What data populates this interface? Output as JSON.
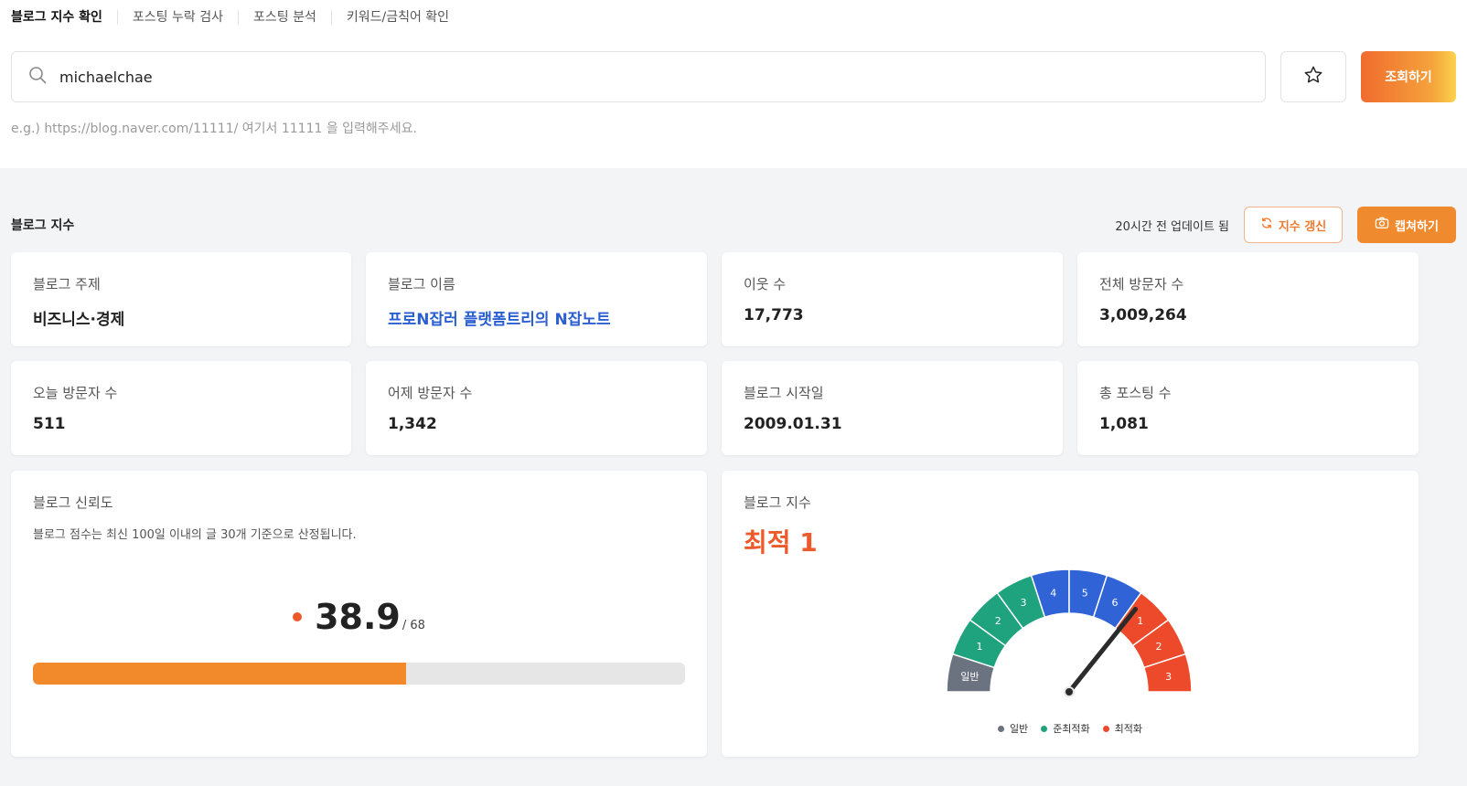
{
  "tabs": [
    "블로그 지수 확인",
    "포스팅 누락 검사",
    "포스팅 분석",
    "키워드/금칙어 확인"
  ],
  "search": {
    "value": "michaelchae",
    "button": "조회하기",
    "hint": "e.g.) https://blog.naver.com/11111/ 여기서 11111 을 입력해주세요."
  },
  "section": {
    "title": "블로그 지수",
    "updated": "20시간 전 업데이트 됨",
    "refresh": "지수 갱신",
    "capture": "캡쳐하기"
  },
  "stats": [
    {
      "label": "블로그 주제",
      "value": "비즈니스·경제"
    },
    {
      "label": "블로그 이름",
      "value": "프로N잡러 플랫폼트리의 N잡노트"
    },
    {
      "label": "이웃 수",
      "value": "17,773"
    },
    {
      "label": "전체 방문자 수",
      "value": "3,009,264"
    },
    {
      "label": "오늘 방문자 수",
      "value": "511"
    },
    {
      "label": "어제 방문자 수",
      "value": "1,342"
    },
    {
      "label": "블로그 시작일",
      "value": "2009.01.31"
    },
    {
      "label": "총 포스팅 수",
      "value": "1,081"
    }
  ],
  "trust": {
    "label": "블로그 신뢰도",
    "desc": "블로그 점수는 최신 100일 이내의 글 30개 기준으로 산정됩니다.",
    "score": "38.9",
    "max": "/ 68",
    "progress_fraction": 0.572
  },
  "index": {
    "label": "블로그 지수",
    "grade": "최적 1",
    "segments": [
      {
        "text": "일반",
        "group": "general"
      },
      {
        "text": "1",
        "group": "semi"
      },
      {
        "text": "2",
        "group": "semi"
      },
      {
        "text": "3",
        "group": "semi"
      },
      {
        "text": "4",
        "group": "blue"
      },
      {
        "text": "5",
        "group": "blue"
      },
      {
        "text": "6",
        "group": "blue"
      },
      {
        "text": "1",
        "group": "optimal"
      },
      {
        "text": "2",
        "group": "optimal"
      },
      {
        "text": "3",
        "group": "optimal"
      }
    ],
    "needle_segment": 7,
    "legend": [
      {
        "text": "일반",
        "color": "#6b7280"
      },
      {
        "text": "준최적화",
        "color": "#1fa27e"
      },
      {
        "text": "최적화",
        "color": "#ec4a2a"
      }
    ],
    "colors": {
      "general": "#6b7280",
      "semi": "#1fa27e",
      "blue": "#2f63d6",
      "optimal": "#ec4a2a"
    }
  }
}
